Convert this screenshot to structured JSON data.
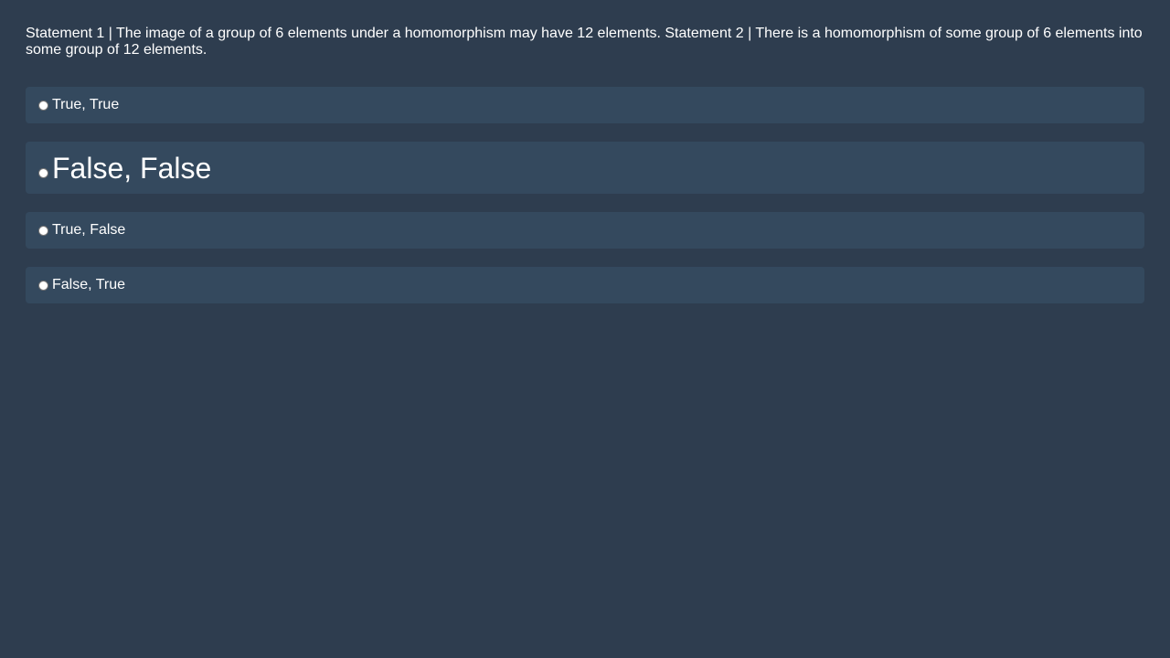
{
  "question": {
    "text": "Statement 1 | The image of a group of 6 elements under a homomorphism may have 12 elements. Statement 2 | There is a homomorphism of some group of 6 elements into some group of 12 elements."
  },
  "options": [
    {
      "label": "True, True",
      "selected": false
    },
    {
      "label": "False, False",
      "selected": false,
      "emphasized": true
    },
    {
      "label": "True, False",
      "selected": false
    },
    {
      "label": "False, True",
      "selected": false
    }
  ],
  "colors": {
    "background": "#2e3d4f",
    "option_background": "#34495e",
    "text": "#ffffff"
  }
}
